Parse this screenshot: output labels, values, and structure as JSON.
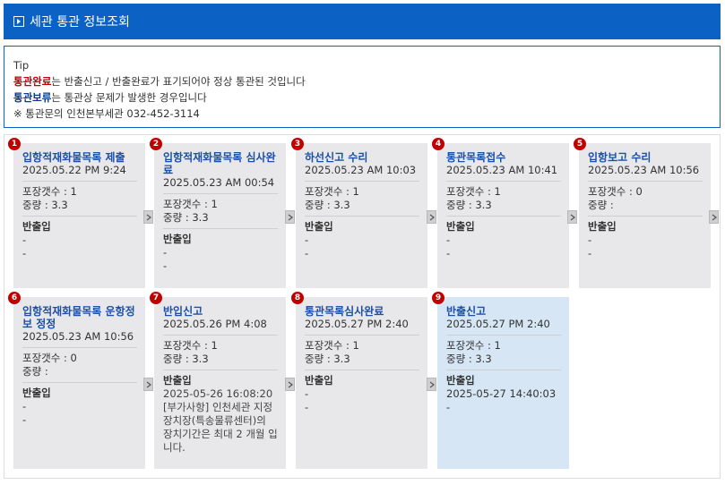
{
  "header": {
    "title": "세관 통관 정보조회"
  },
  "tip": {
    "label": "Tip",
    "line1_strong": "통관완료",
    "line1_rest": "는 반출신고 / 반출완료가 표기되어야 정상 통관된 것입니다",
    "line2_strong": "통관보류",
    "line2_rest": "는 통관상 문제가 발생한 경우입니다",
    "line3": "※ 통관문의 인천본부세관 032-452-3114"
  },
  "steps": [
    {
      "num": "1",
      "title": "입항적재화물목록 제출",
      "date": "2025.05.22 PM 9:24",
      "pkg": "포장갯수 : 1",
      "weight": "중량 : 3.3",
      "sub": "반출입",
      "l1": "-",
      "l2": "-"
    },
    {
      "num": "2",
      "title": "입항적재화물목록 심사완료",
      "date": "2025.05.23 AM 00:54",
      "pkg": "포장갯수 : 1",
      "weight": "중량 : 3.3",
      "sub": "반출입",
      "l1": "-",
      "l2": "-"
    },
    {
      "num": "3",
      "title": "하선신고 수리",
      "date": "2025.05.23 AM 10:03",
      "pkg": "포장갯수 : 1",
      "weight": "중량 : 3.3",
      "sub": "반출입",
      "l1": "-",
      "l2": "-"
    },
    {
      "num": "4",
      "title": "통관목록접수",
      "date": "2025.05.23 AM 10:41",
      "pkg": "포장갯수 : 1",
      "weight": "중량 : 3.3",
      "sub": "반출입",
      "l1": "-",
      "l2": "-"
    },
    {
      "num": "5",
      "title": "입항보고 수리",
      "date": "2025.05.23 AM 10:56",
      "pkg": "포장갯수 : 0",
      "weight": "중량 :",
      "sub": "반출입",
      "l1": "-",
      "l2": "-"
    },
    {
      "num": "6",
      "title": "입항적재화물목록 운항정보 정정",
      "date": "2025.05.23 AM 10:56",
      "pkg": "포장갯수 : 0",
      "weight": "중량 :",
      "sub": "반출입",
      "l1": "-",
      "l2": "-"
    },
    {
      "num": "7",
      "title": "반입신고",
      "date": "2025.05.26 PM 4:08",
      "pkg": "포장갯수 : 1",
      "weight": "중량 : 3.3",
      "sub": "반출입",
      "l1": "2025-05-26 16:08:20",
      "l2": "[부가사항] 인천세관 지정장치장(특송물류센터)의 장치기간은 최대 2 개월 입니다."
    },
    {
      "num": "8",
      "title": "통관목록심사완료",
      "date": "2025.05.27 PM 2:40",
      "pkg": "포장갯수 : 1",
      "weight": "중량 : 3.3",
      "sub": "반출입",
      "l1": "-",
      "l2": "-"
    },
    {
      "num": "9",
      "title": "반출신고",
      "date": "2025.05.27 PM 2:40",
      "pkg": "포장갯수 : 1",
      "weight": "중량 : 3.3",
      "sub": "반출입",
      "l1": "2025-05-27 14:40:03",
      "l2": "-"
    }
  ],
  "colors": {
    "header_bg": "#0b62c4",
    "badge": "#c00000",
    "title_link": "#1a50a8",
    "highlight": "#d6e6f4"
  }
}
